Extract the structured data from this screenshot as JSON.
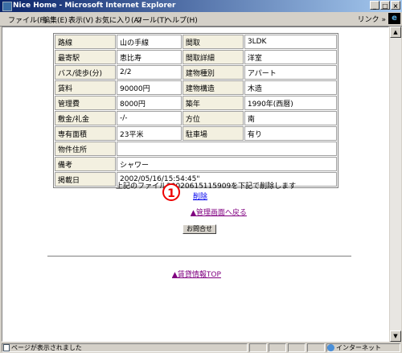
{
  "window": {
    "title": "Nice Home - Microsoft Internet Explorer",
    "buttons": {
      "minimize": "_",
      "maximize": "□",
      "close": "×"
    }
  },
  "menubar": {
    "items": [
      "ファイル(F)",
      "編集(E)",
      "表示(V)",
      "お気に入り(A)",
      "ツール(T)",
      "ヘルプ(H)"
    ],
    "links_label": "リンク »"
  },
  "property": {
    "rows": [
      {
        "label": "路線",
        "value": "山の手線",
        "label2": "間取",
        "value2": "3LDK"
      },
      {
        "label": "最寄駅",
        "value": "恵比寿",
        "label2": "間取詳細",
        "value2": "洋室"
      },
      {
        "label": "バス/徒歩(分)",
        "value": "2/2",
        "label2": "建物種別",
        "value2": "アパート"
      },
      {
        "label": "賃料",
        "value": "90000円",
        "label2": "建物構造",
        "value2": "木造"
      },
      {
        "label": "管理費",
        "value": "8000円",
        "label2": "築年",
        "value2": "1990年(西暦)"
      },
      {
        "label": "敷金/礼金",
        "value": "-/-",
        "label2": "方位",
        "value2": "南"
      },
      {
        "label": "専有面積",
        "value": "23平米",
        "label2": "駐車場",
        "value2": "有り"
      }
    ],
    "address_label": "物件住所",
    "address_value": "",
    "remarks_label": "備考",
    "remarks_value": "シャワー",
    "posted_label": "掲載日",
    "posted_value": "2002/05/16/15:54:45\""
  },
  "action": {
    "message": "上記のファイル20020615115909を下記で削除します",
    "badge": "1",
    "delete_link": "削除",
    "back_link": "▲管理画面へ戻る",
    "inquiry_button": "お問合せ",
    "top_link": "▲賃貸情報TOP"
  },
  "statusbar": {
    "text": "ページが表示されました",
    "zone": "インターネット"
  },
  "icons": {
    "browser": "ie-logo",
    "page": "page-icon",
    "zone": "globe-icon"
  }
}
